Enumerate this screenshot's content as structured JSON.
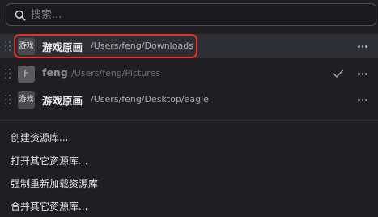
{
  "search": {
    "placeholder": "搜索..."
  },
  "libraries": [
    {
      "thumb_text": "游戏",
      "name": "游戏原画",
      "path": "/Users/feng/Downloads",
      "selected": true,
      "current": false
    },
    {
      "thumb_text": "F",
      "name": "feng",
      "path": "/Users/feng/Pictures",
      "selected": false,
      "current": true
    },
    {
      "thumb_text": "游戏",
      "name": "游戏原画",
      "path": "/Users/feng/Desktop/eagle",
      "selected": false,
      "current": false
    }
  ],
  "menu": {
    "items": [
      "创建资源库...",
      "打开其它资源库...",
      "强制重新加载资源库",
      "合并其它资源库..."
    ]
  },
  "colors": {
    "background": "#1f1f23",
    "selected_row": "#2e2f34",
    "highlight_border": "#e8312a",
    "text_primary": "#ececee",
    "text_secondary": "#a9aab0"
  },
  "icons": {
    "search": "search-icon",
    "drag": "drag-handle-icon",
    "more": "more-horizontal-icon",
    "current": "checkmark-icon"
  }
}
